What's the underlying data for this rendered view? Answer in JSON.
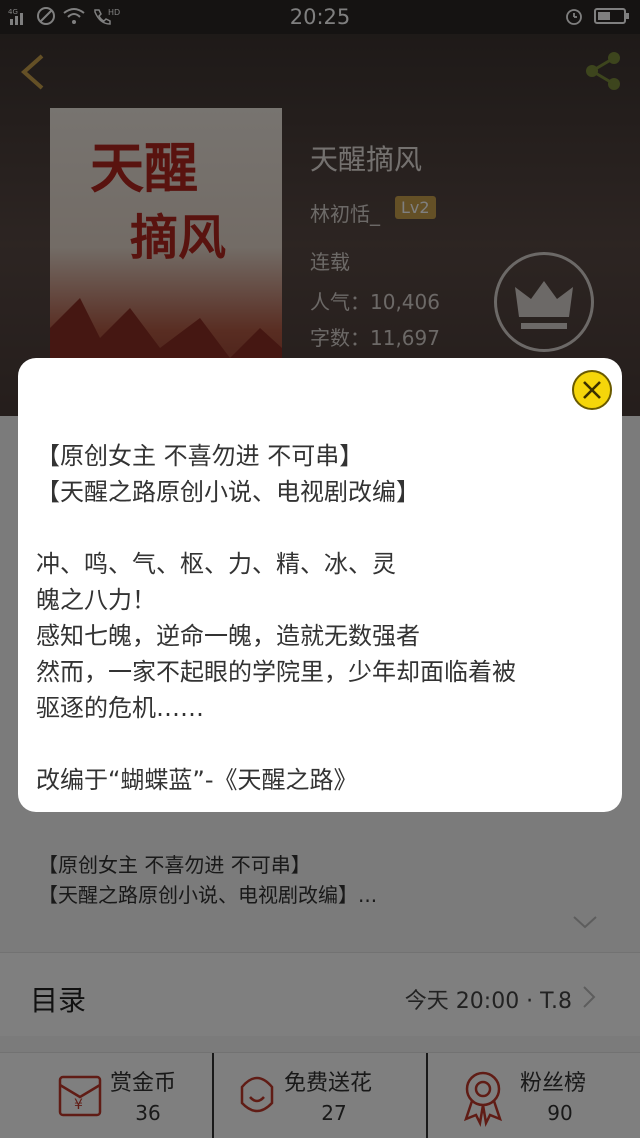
{
  "status_bar": {
    "time": "20:25",
    "network_label": "4G",
    "hd_label": "HD"
  },
  "book": {
    "cover_title_line1": "天醒",
    "cover_title_line2": "摘风",
    "title": "天醒摘风",
    "author": "林初恬_",
    "author_level": "Lv2",
    "serial_status": "连载",
    "popularity": "人气：10,406",
    "word_count": "字数：11,697"
  },
  "intro_preview": {
    "line1": "【原创女主 不喜勿进 不可串】",
    "line2": "【天醒之路原创小说、电视剧改编】..."
  },
  "toc": {
    "label": "目录",
    "update": "今天 20:00 · T.8"
  },
  "bottom_bar": [
    {
      "icon": "red-envelope-icon",
      "label": "赏金币",
      "count": "36"
    },
    {
      "icon": "flower-icon",
      "label": "免费送花",
      "count": "27"
    },
    {
      "icon": "ribbon-badge-icon",
      "label": "粉丝榜",
      "count": "90"
    }
  ],
  "modal": {
    "line1": "【原创女主 不喜勿进 不可串】",
    "line2": "【天醒之路原创小说、电视剧改编】",
    "line3": "冲、鸣、气、枢、力、精、冰、灵",
    "line4": "魄之八力！",
    "line5": "感知七魄，逆命一魄，造就无数强者",
    "line6": "然而，一家不起眼的学院里，少年却面临着被",
    "line7": "驱逐的危机……",
    "line8": "改编于“蝴蝶蓝”-《天醒之路》"
  },
  "colors": {
    "accent_yellow": "#f5d60a",
    "header_brown": "#4a3c38",
    "level_badge": "#c9a04c"
  }
}
